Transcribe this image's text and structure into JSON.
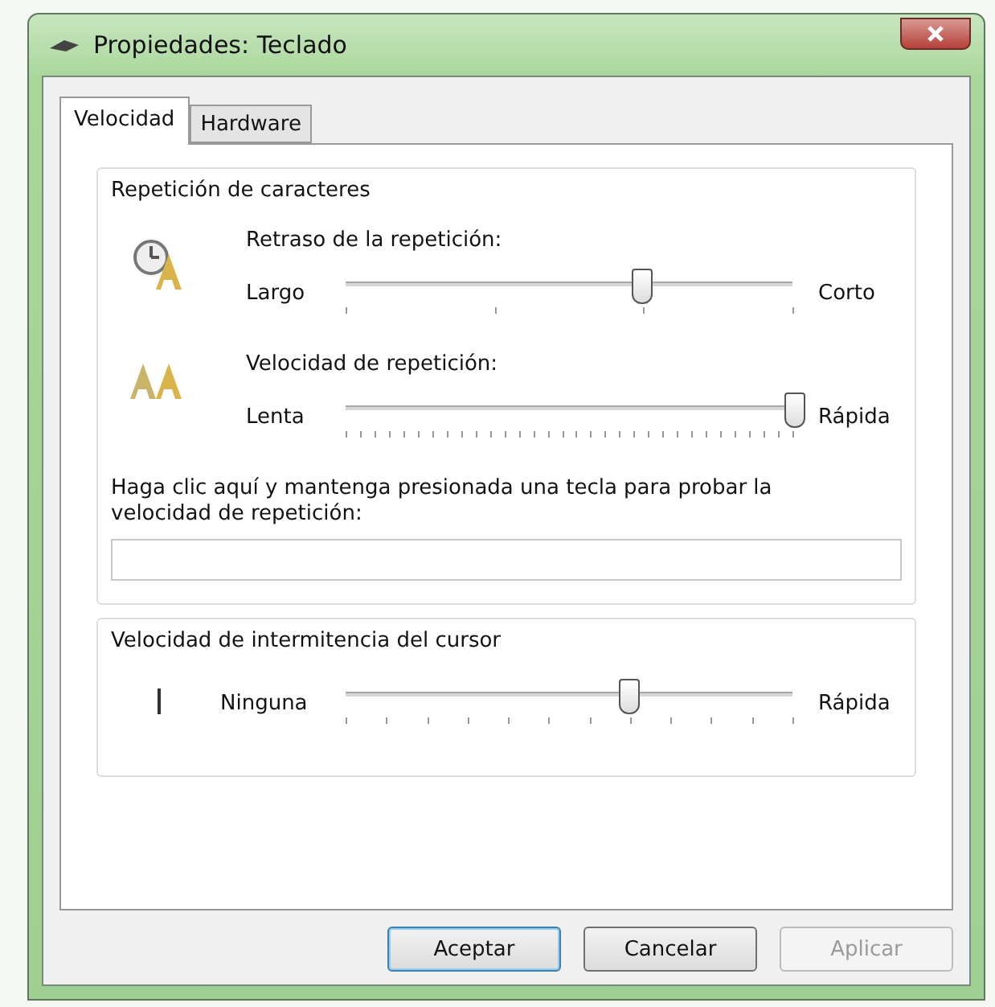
{
  "window": {
    "title": "Propiedades: Teclado"
  },
  "tabs": [
    {
      "label": "Velocidad",
      "selected": true
    },
    {
      "label": "Hardware",
      "selected": false
    }
  ],
  "character_repeat": {
    "title": "Repetición de caracteres",
    "sliders": [
      {
        "kind": "delay",
        "label": "Retraso de la repetición:",
        "min_label": "Largo",
        "max_label": "Corto",
        "level": 0.66
      },
      {
        "kind": "rate",
        "label": "Velocidad de repetición:",
        "min_label": "Lenta",
        "max_label": "Rápida",
        "level": 1
      }
    ],
    "test_prompt": "Haga clic aquí y mantenga presionada una tecla para probar la velocidad de repetición:"
  },
  "cursor_blink": {
    "title": "Velocidad de intermitencia del cursor",
    "min_label": "Ninguna",
    "max_label": "Rápida",
    "level": 0.63
  },
  "buttons": [
    {
      "label": "Aceptar",
      "default": true,
      "disabled": false
    },
    {
      "label": "Cancelar",
      "default": false,
      "disabled": false
    },
    {
      "label": "Aplicar",
      "default": false,
      "disabled": true
    }
  ]
}
